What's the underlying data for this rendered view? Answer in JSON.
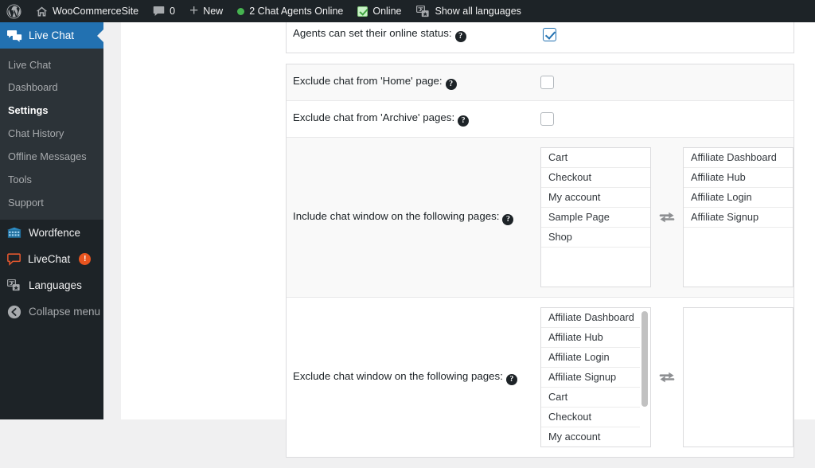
{
  "adminbar": {
    "items": [
      {
        "id": "wp-logo",
        "icon": "wordpress-logo-icon",
        "label": ""
      },
      {
        "id": "site-name",
        "icon": "home-icon",
        "label": "WooCommerceSite"
      },
      {
        "id": "comments",
        "icon": "comment-bubble-icon",
        "label": "0"
      },
      {
        "id": "new-content",
        "icon": "plus-icon",
        "label": "New"
      },
      {
        "id": "agents",
        "icon": "green-status-dot-icon",
        "label": "2 Chat Agents Online"
      },
      {
        "id": "online",
        "icon": "green-checkbox-icon",
        "label": "Online"
      },
      {
        "id": "languages",
        "icon": "translate-icon",
        "label": "Show all languages"
      }
    ]
  },
  "sidebar": {
    "current_menu": "Live Chat",
    "submenu": [
      {
        "label": "Live Chat",
        "current": false
      },
      {
        "label": "Dashboard",
        "current": false
      },
      {
        "label": "Settings",
        "current": true
      },
      {
        "label": "Chat History",
        "current": false
      },
      {
        "label": "Offline Messages",
        "current": false
      },
      {
        "label": "Tools",
        "current": false
      },
      {
        "label": "Support",
        "current": false
      }
    ],
    "plugins": [
      {
        "label": "Wordfence",
        "icon": "wordfence-icon",
        "badge": ""
      },
      {
        "label": "LiveChat",
        "icon": "livechat-bubble-icon",
        "badge": "!"
      },
      {
        "label": "Languages",
        "icon": "translate-icon",
        "badge": ""
      }
    ],
    "collapse": {
      "label": "Collapse menu",
      "icon": "collapse-arrow-icon"
    }
  },
  "settings": {
    "rows": [
      {
        "id": "agents-online-status",
        "label": "Agents can set their online status:",
        "help": "?",
        "type": "checkbox",
        "checked": true
      },
      {
        "id": "exclude-home",
        "label": "Exclude chat from 'Home' page:",
        "help": "?",
        "type": "checkbox",
        "checked": false
      },
      {
        "id": "exclude-archive",
        "label": "Exclude chat from 'Archive' pages:",
        "help": "?",
        "type": "checkbox",
        "checked": false
      },
      {
        "id": "include-pages",
        "label": "Include chat window on the following pages:",
        "help": "?",
        "type": "duallist",
        "swap_icon": "swap-arrows-icon",
        "left": {
          "items": [
            "Cart",
            "Checkout",
            "My account",
            "Sample Page",
            "Shop"
          ],
          "scrollbar": false
        },
        "right": {
          "items": [
            "Affiliate Dashboard",
            "Affiliate Hub",
            "Affiliate Login",
            "Affiliate Signup"
          ],
          "scrollbar": false
        }
      },
      {
        "id": "exclude-pages",
        "label": "Exclude chat window on the following pages:",
        "help": "?",
        "type": "duallist",
        "swap_icon": "swap-arrows-icon",
        "left": {
          "items": [
            "Affiliate Dashboard",
            "Affiliate Hub",
            "Affiliate Login",
            "Affiliate Signup",
            "Cart",
            "Checkout",
            "My account"
          ],
          "scrollbar": true
        },
        "right": {
          "items": [],
          "scrollbar": false
        }
      }
    ]
  },
  "colors": {
    "admin_bar": "#1d2327",
    "sidebar": "#1d2327",
    "submenu": "#2c3338",
    "accent_blue": "#2271b1",
    "online_green": "#46b450",
    "alert_orange": "#e8541f",
    "livechat_orange": "#e4572e"
  }
}
